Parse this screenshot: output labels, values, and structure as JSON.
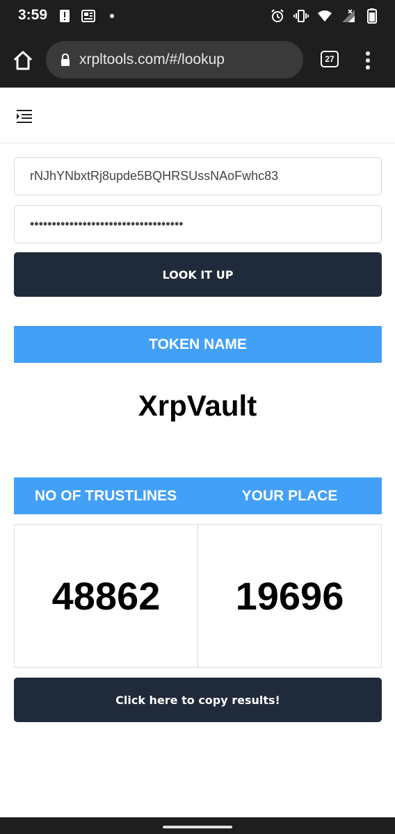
{
  "status_bar": {
    "time": "3:59",
    "icons_left": [
      "alert-icon",
      "news-icon",
      "dot-icon"
    ],
    "icons_right": [
      "alarm-icon",
      "vibrate-icon",
      "wifi-icon",
      "signal-icon",
      "battery-icon"
    ]
  },
  "browser": {
    "url": "xrpltools.com/#/lookup",
    "tab_count": "27"
  },
  "form": {
    "address_value": "rNJhYNbxtRj8upde5BQHRSUssNAoFwhc83",
    "secret_value": "•••••••••••••••••••••••••••••••••••",
    "lookup_label": "LOOK IT UP"
  },
  "token": {
    "header": "TOKEN NAME",
    "name": "XrpVault"
  },
  "stats": {
    "trustlines_header": "NO OF TRUSTLINES",
    "place_header": "YOUR PLACE",
    "trustlines_value": "48862",
    "place_value": "19696"
  },
  "copy_label": "Click here to copy results!",
  "colors": {
    "dark_button": "#1f2a3a",
    "blue_banner": "#42a0f8",
    "browser_bg": "#1e1e1e"
  }
}
